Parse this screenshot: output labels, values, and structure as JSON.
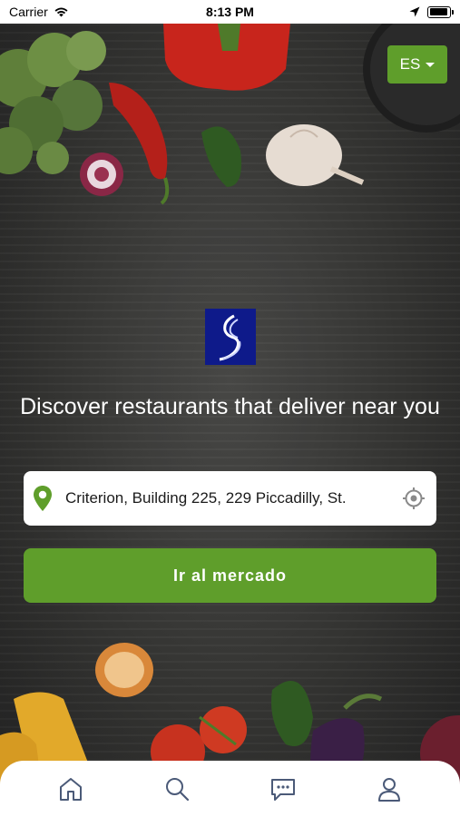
{
  "status_bar": {
    "carrier": "Carrier",
    "time": "8:13 PM",
    "battery_level": 0.95
  },
  "language_selector": {
    "value": "ES"
  },
  "hero": {
    "tagline": "Discover restaurants that deliver near you"
  },
  "address": {
    "value": "Criterion, Building 225, 229 Piccadilly, St."
  },
  "go_button": {
    "label": "Ir al mercado"
  },
  "tab_bar": {
    "items": [
      "home-icon",
      "search-icon",
      "chat-icon",
      "profile-icon"
    ]
  },
  "colors": {
    "accent": "#5f9e2b",
    "logo_bg": "#0e1a8a",
    "tab_icon": "#4b5a78"
  }
}
